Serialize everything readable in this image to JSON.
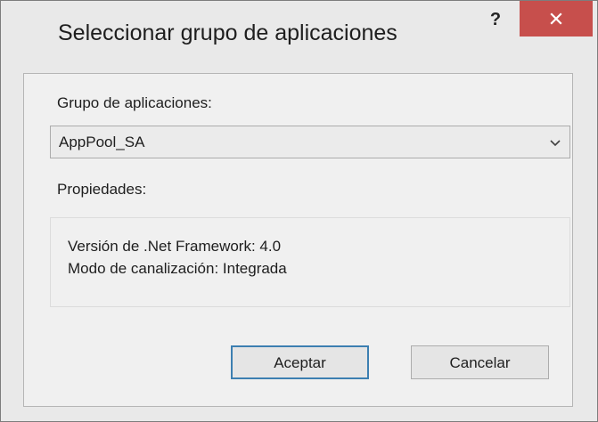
{
  "dialog": {
    "title": "Seleccionar grupo de aplicaciones",
    "help_label": "?",
    "close_icon": "close-icon"
  },
  "form": {
    "pool_label": "Grupo de aplicaciones:",
    "pool_selected": "AppPool_SA",
    "properties_label": "Propiedades:",
    "properties": [
      "Versión de .Net Framework: 4.0",
      "Modo de canalización: Integrada"
    ]
  },
  "buttons": {
    "ok_label": "Aceptar",
    "cancel_label": "Cancelar"
  },
  "colors": {
    "close_button": "#c74f4c",
    "default_button_border": "#3c7fb1"
  }
}
